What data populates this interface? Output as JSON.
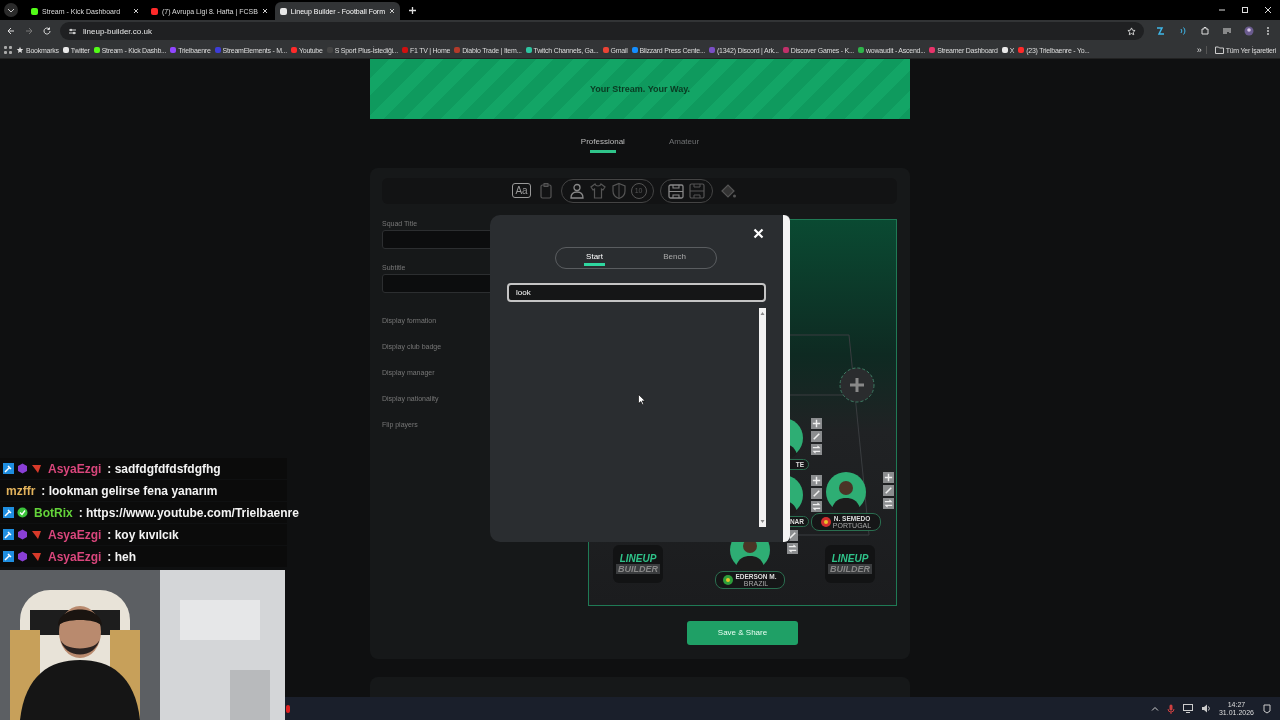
{
  "browser": {
    "tabs": [
      {
        "title": "Stream - Kick Dashboard",
        "color": "#53fc18",
        "selected": false
      },
      {
        "title": "(7) Avrupa Ligi 8. Hafta | FCSB",
        "color": "#ff2a2a",
        "selected": false
      },
      {
        "title": "Lineup Builder - Football Form",
        "color": "#e8e8e8",
        "selected": true
      }
    ],
    "url": "lineup-builder.co.uk",
    "bookmarks": [
      {
        "label": "Bookmarks",
        "kind": "star"
      },
      {
        "label": "Twitter",
        "kind": "site",
        "color": "#e8e8e8"
      },
      {
        "label": "Stream - Kick Dashb...",
        "kind": "site",
        "color": "#53fc18"
      },
      {
        "label": "Trielbaenre",
        "kind": "site",
        "color": "#9146ff"
      },
      {
        "label": "StreamElements - M...",
        "kind": "site",
        "color": "#3d3dd6"
      },
      {
        "label": "Youtube",
        "kind": "site",
        "color": "#ff2a2a"
      },
      {
        "label": "S Sport Plus-İstediği...",
        "kind": "site",
        "color": "#444444"
      },
      {
        "label": "F1 TV | Home",
        "kind": "site",
        "color": "#d01010"
      },
      {
        "label": "Diablo Trade | Item...",
        "kind": "site",
        "color": "#b33a2a"
      },
      {
        "label": "Twitch Channels, Ga...",
        "kind": "site",
        "color": "#2ec4a0"
      },
      {
        "label": "Gmail",
        "kind": "site",
        "color": "#ea4335"
      },
      {
        "label": "Blizzard Press Cente...",
        "kind": "site",
        "color": "#148eff"
      },
      {
        "label": "(1342) Discord | Ark...",
        "kind": "site",
        "color": "#7a4fc4"
      },
      {
        "label": "Discover Games - K...",
        "kind": "site",
        "color": "#c0306a"
      },
      {
        "label": "wowaudit - Ascend...",
        "kind": "site",
        "color": "#2fb34a"
      },
      {
        "label": "Streamer Dashboard",
        "kind": "site",
        "color": "#e8336a"
      },
      {
        "label": "X",
        "kind": "site",
        "color": "#e8e8e8"
      },
      {
        "label": "(23) Trielbaenre - Yo...",
        "kind": "site",
        "color": "#ff2a2a"
      }
    ],
    "more": "»",
    "all_bookmarks": "Tüm Yer İşaretleri"
  },
  "page": {
    "banner": "Your Stream. Your Way.",
    "tabs": [
      {
        "label": "Professional",
        "selected": true
      },
      {
        "label": "Amateur",
        "selected": false
      }
    ],
    "tools": [
      {
        "kind": "text",
        "label": "Aa"
      },
      {
        "kind": "clipboard"
      },
      {
        "kind": "group",
        "items": [
          {
            "kind": "person"
          },
          {
            "kind": "shirt"
          },
          {
            "kind": "shield"
          },
          {
            "kind": "number",
            "label": "10"
          }
        ]
      },
      {
        "kind": "group",
        "items": [
          {
            "kind": "pitch"
          },
          {
            "kind": "layout"
          }
        ]
      },
      {
        "kind": "paint"
      }
    ],
    "form": [
      {
        "kind": "input",
        "label": "Squad Title"
      },
      {
        "kind": "input",
        "label": "Subtitle"
      },
      {
        "kind": "option",
        "label": "Display formation"
      },
      {
        "kind": "option",
        "label": "Display club badge"
      },
      {
        "kind": "option",
        "label": "Display manager"
      },
      {
        "kind": "option",
        "label": "Display nationality"
      },
      {
        "kind": "option",
        "label": "Flip players"
      }
    ],
    "pitch": [
      {
        "kind": "empty"
      },
      {
        "kind": "cut",
        "name": "TE",
        "tools": [
          {
            "kind": "move"
          },
          {
            "kind": "edit"
          },
          {
            "kind": "swap"
          }
        ]
      },
      {
        "kind": "cut",
        "name": "NAR",
        "tools": [
          {
            "kind": "move"
          },
          {
            "kind": "edit"
          },
          {
            "kind": "swap"
          }
        ]
      },
      {
        "kind": "player",
        "name": "N. SEMEDO",
        "country": "PORTUGAL",
        "color": "#d32f2f",
        "tools": [
          {
            "kind": "move"
          },
          {
            "kind": "edit"
          },
          {
            "kind": "swap"
          }
        ]
      },
      {
        "kind": "player",
        "name": "EDERSON M.",
        "country": "BRAZIL",
        "color": "#2e9d3a",
        "tools": [
          {
            "kind": "edit"
          },
          {
            "kind": "swap"
          }
        ]
      },
      {
        "kind": "logo",
        "line1": "LINEUP",
        "line2": "BUILDER"
      },
      {
        "kind": "logo",
        "line1": "LINEUP",
        "line2": "BUILDER"
      }
    ],
    "save": "Save & Share"
  },
  "modal": {
    "tabs": [
      {
        "label": "Start",
        "selected": true
      },
      {
        "label": "Bench",
        "selected": false
      }
    ],
    "search": "look"
  },
  "chat": [
    {
      "user": "AsyaEzgi",
      "color": "#d9467c",
      "badges": [
        {
          "kind": "mod"
        },
        {
          "kind": "cube"
        },
        {
          "kind": "gem"
        }
      ],
      "text": ": sadfdgfdfdsfdgfhg"
    },
    {
      "user": "mzffr",
      "color": "#e3b35c",
      "text": ": lookman gelirse fena yanarım"
    },
    {
      "user": "BotRix",
      "color": "#64d43a",
      "badges": [
        {
          "kind": "mod"
        },
        {
          "kind": "check"
        }
      ],
      "text": ": https://www.youtube.com/Trielbaenre"
    },
    {
      "user": "AsyaEzgi",
      "color": "#d9467c",
      "badges": [
        {
          "kind": "mod"
        },
        {
          "kind": "cube"
        },
        {
          "kind": "gem"
        }
      ],
      "text": ": koy kıvılcık"
    },
    {
      "user": "AsyaEzgi",
      "color": "#d9467c",
      "badges": [
        {
          "kind": "mod"
        },
        {
          "kind": "cube"
        },
        {
          "kind": "gem"
        }
      ],
      "text": ": heh"
    }
  ],
  "taskbar": {
    "time": "14:27",
    "date": "31.01.2026"
  }
}
